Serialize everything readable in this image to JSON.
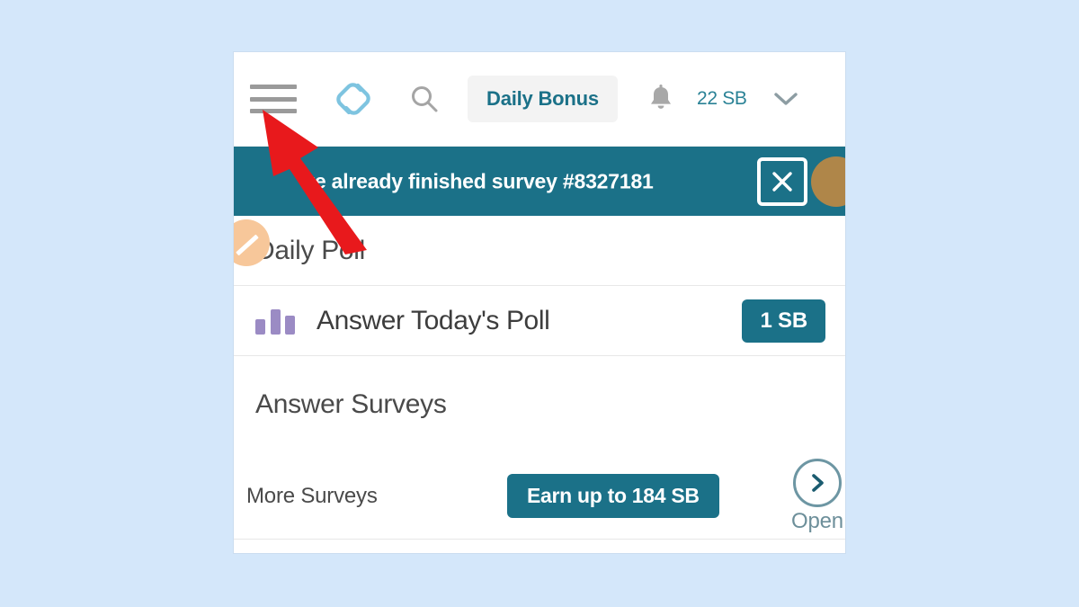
{
  "page": {
    "background_color": "#d4e7fa",
    "frame_background": "#ffffff"
  },
  "colors": {
    "teal": "#1b7188",
    "teal_text": "#2a8296",
    "purple": "#9b8bc4",
    "gray_text": "#4a4a4a",
    "arrow_red": "#e8191c"
  },
  "header": {
    "menu_icon": "hamburger-menu-icon",
    "logo_icon": "swagbucks-logo-icon",
    "search_icon": "search-icon",
    "daily_bonus_label": "Daily Bonus",
    "bell_icon": "notification-bell-icon",
    "sb_balance": "22 SB",
    "chevron_icon": "chevron-down-icon"
  },
  "banner": {
    "message": "'ve already finished survey #8327181",
    "close_icon": "close-x-icon",
    "avatar_icon": "user-avatar-icon"
  },
  "daily_poll": {
    "section_title": "Daily Poll",
    "poll_icon": "bar-chart-icon",
    "poll_label": "Answer Today's Poll",
    "poll_reward": "1 SB",
    "avatar_icon": "edit-pencil-avatar-icon"
  },
  "answer_surveys": {
    "section_title": "Answer Surveys",
    "more_surveys_label": "More Surveys",
    "earn_button_label": "Earn up to 184 SB",
    "open_icon": "chevron-right-circle-icon",
    "open_label": "Open"
  },
  "annotation": {
    "arrow_icon": "red-arrow-pointer",
    "points_at": "hamburger-menu-icon"
  }
}
